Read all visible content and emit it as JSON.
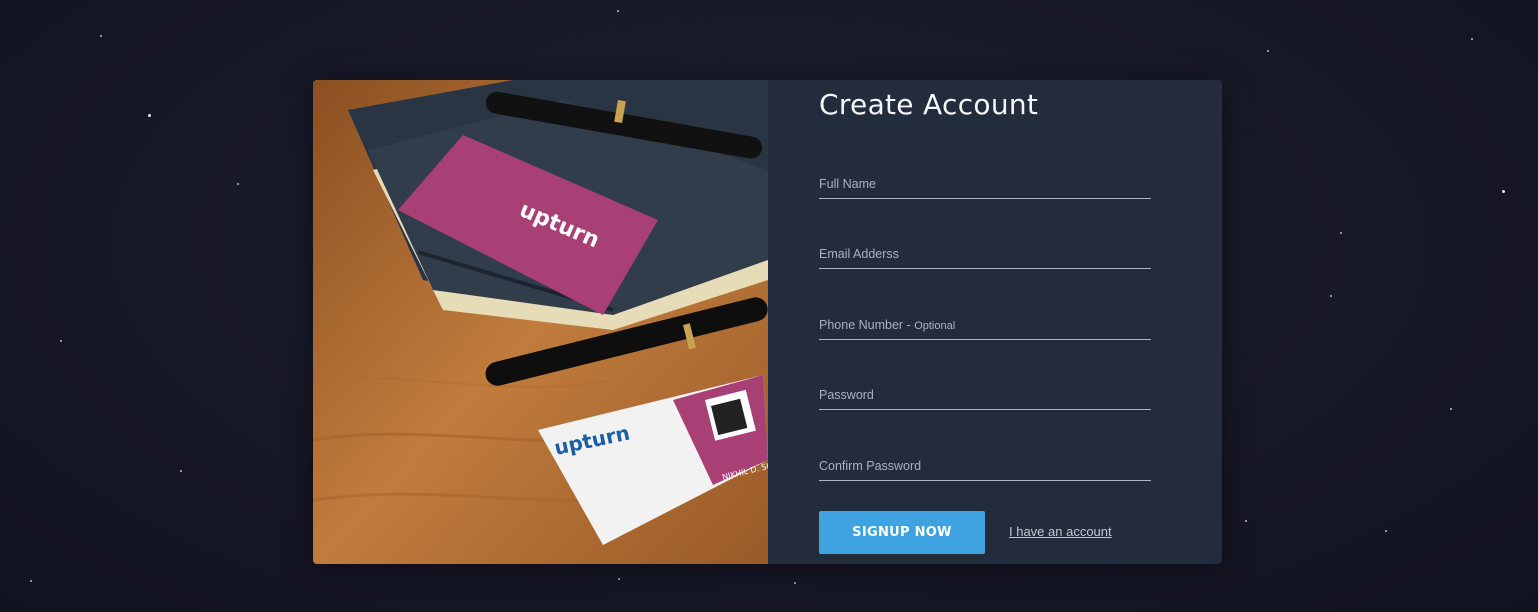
{
  "form": {
    "title": "Create Account",
    "fields": [
      {
        "label": "Full Name"
      },
      {
        "label": "Email Adderss"
      },
      {
        "label": "Phone Number - ",
        "optional": "Optional"
      },
      {
        "label": "Password"
      },
      {
        "label": "Confirm Password"
      }
    ],
    "signup_label": "SIGNUP NOW",
    "login_link": "I have an account"
  },
  "photo": {
    "brand": "upturn",
    "card_name": "NIKHIL D. SH"
  },
  "colors": {
    "background": "#171827",
    "panel": "#222c3c",
    "accent": "#3ea3e0",
    "card_pink": "#a83f75"
  }
}
